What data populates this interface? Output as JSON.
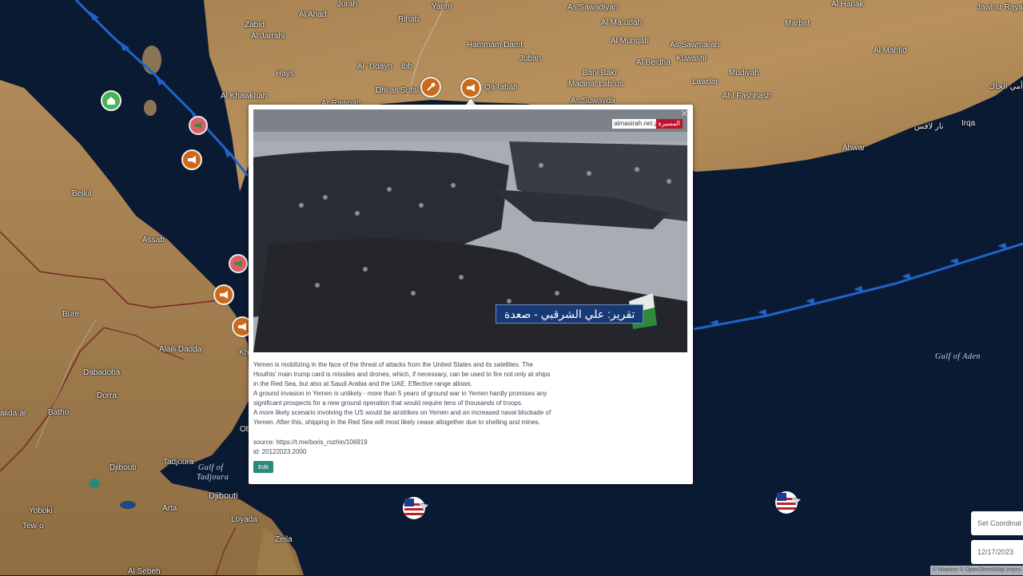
{
  "map": {
    "places": [
      {
        "name": "Zabid"
      },
      {
        "name": "Al Jarrahi"
      },
      {
        "name": "Al Ahad"
      },
      {
        "name": "Jurah"
      },
      {
        "name": "Rihab"
      },
      {
        "name": "Yarim"
      },
      {
        "name": "As Sawadiyah"
      },
      {
        "name": "Al Hanak"
      },
      {
        "name": "Jawl ar Rayah"
      },
      {
        "name": "Al Ma`udah"
      },
      {
        "name": "Hammam Damt"
      },
      {
        "name": "Al Munqati"
      },
      {
        "name": "As Sawma`ah"
      },
      {
        "name": "Marbat"
      },
      {
        "name": "Al Mahfid"
      },
      {
        "name": "Hays"
      },
      {
        "name": "Al `Udayn"
      },
      {
        "name": "Ibb"
      },
      {
        "name": "Juban"
      },
      {
        "name": "Kuwashi"
      },
      {
        "name": "Al Beidha"
      },
      {
        "name": "Bani Bakr"
      },
      {
        "name": "Mudiyah"
      },
      {
        "name": "Madinat Lab`us"
      },
      {
        "name": "Lawdar"
      },
      {
        "name": "Al Khawkhah"
      },
      {
        "name": "Dhi as Sufal"
      },
      {
        "name": "Qa`tabah"
      },
      {
        "name": "As Suwayda"
      },
      {
        "name": "Ahl Fashhash"
      },
      {
        "name": "Ar Rawnah"
      },
      {
        "name": "Irqa"
      },
      {
        "name": "Ahwar"
      },
      {
        "name": "Beilul"
      },
      {
        "name": "Assab"
      },
      {
        "name": "Bure"
      },
      {
        "name": "Alaili Dadda`"
      },
      {
        "name": "Dabadoba"
      },
      {
        "name": "Dorra"
      },
      {
        "name": "Batho"
      },
      {
        "name": "alida`ar"
      },
      {
        "name": "Djibouti"
      },
      {
        "name": "Tadjoura"
      },
      {
        "name": "Yoboki"
      },
      {
        "name": "Tew`o"
      },
      {
        "name": "Arta"
      },
      {
        "name": "Djibouti"
      },
      {
        "name": "Loyada"
      },
      {
        "name": "Zeila"
      },
      {
        "name": "Kh"
      },
      {
        "name": "Ob"
      },
      {
        "name": "Al Sebeh"
      },
      {
        "name": "أمي الحاك"
      },
      {
        "name": "نار لافس"
      }
    ],
    "water_labels": {
      "gulf_aden": "Gulf of Aden",
      "gulf_tadjoura_1": "Gulf of",
      "gulf_tadjoura_2": "Tadjoura"
    },
    "colors": {
      "sea": "#0b1a33",
      "land": "#b58c5a",
      "route": "#1e64c8",
      "border": "#8a2a2a"
    }
  },
  "markers": [
    {
      "type": "megaphone",
      "color": "#c96a1c"
    },
    {
      "type": "tool",
      "color": "#c96a1c"
    },
    {
      "type": "house",
      "color": "#49b25b"
    },
    {
      "type": "megaphone",
      "color": "#d8606a"
    },
    {
      "type": "megaphone",
      "color": "#c96a1c"
    },
    {
      "type": "megaphone",
      "color": "#d8606a"
    },
    {
      "type": "megaphone",
      "color": "#c96a1c"
    },
    {
      "type": "megaphone",
      "color": "#c96a1c"
    },
    {
      "type": "us-flag-ship",
      "color": "#ffffff"
    },
    {
      "type": "us-flag-ship",
      "color": "#ffffff"
    }
  ],
  "popup": {
    "watermark": "almasirah.net.ye",
    "watermark_logo": "المسيرة",
    "caption": "تقرير: علي الشرقبي - صعدة",
    "lines": [
      "Yemen is mobilizing in the face of the threat of attacks from the United States and its satellites. The",
      "Houthis' main trump card is missiles and drones, which, if necessary, can be used to fire not only at ships",
      "in the Red Sea, but also at Saudi Arabia and the UAE. Effective range allows.",
      "A ground invasion in Yemen is unlikely - more than 5 years of ground war in Yemen hardly promises any",
      "significant prospects for a new ground operation that would require tens of thousands of troops.",
      "A more likely scenario involving the US would be airstrikes on Yemen and an increased naval blockade of",
      "Yemen. After this, shipping in the Red Sea will most likely cease altogether due to shelling and mines."
    ],
    "source": "source: https://t.me/boris_rozhin/106919",
    "id": "id: 20122023.2000",
    "edit_label": "Edit",
    "close_label": "×"
  },
  "controls": {
    "set_coordinates": "Set Coordinat",
    "date": "12/17/2023"
  },
  "attribution": "© Mapbox © OpenStreetMap Impro"
}
